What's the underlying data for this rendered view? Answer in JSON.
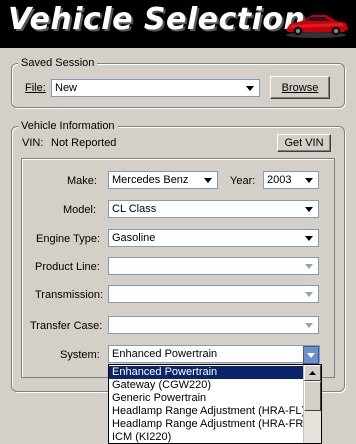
{
  "header": {
    "title": "Vehicle Selection",
    "logo_icon": "red-sports-car"
  },
  "saved_session": {
    "legend": "Saved Session",
    "file_label": "File:",
    "file_value": "New",
    "browse_label": "Browse"
  },
  "vehicle_info": {
    "legend": "Vehicle Information",
    "vin_label": "VIN:",
    "vin_value": "Not Reported",
    "get_vin_label": "Get VIN",
    "make_label": "Make:",
    "make_value": "Mercedes Benz",
    "year_label": "Year:",
    "year_value": "2003",
    "model_label": "Model:",
    "model_value": "CL Class",
    "engine_label": "Engine Type:",
    "engine_value": "Gasoline",
    "product_line_label": "Product Line:",
    "product_line_value": "",
    "transmission_label": "Transmission:",
    "transmission_value": "",
    "transfer_case_label": "Transfer Case:",
    "transfer_case_value": "",
    "system_label": "System:",
    "system_value": "Enhanced Powertrain"
  },
  "system_dropdown": {
    "options": [
      "Enhanced Powertrain",
      "Gateway (CGW220)",
      "Generic Powertrain",
      "Headlamp Range Adjustment (HRA-FL)",
      "Headlamp Range Adjustment (HRA-FR)",
      "ICM (KI220)"
    ],
    "selected_index": 0
  },
  "colors": {
    "header_bg": "#000000",
    "selection": "#0a246a",
    "window_bg": "#d4d0c8"
  }
}
